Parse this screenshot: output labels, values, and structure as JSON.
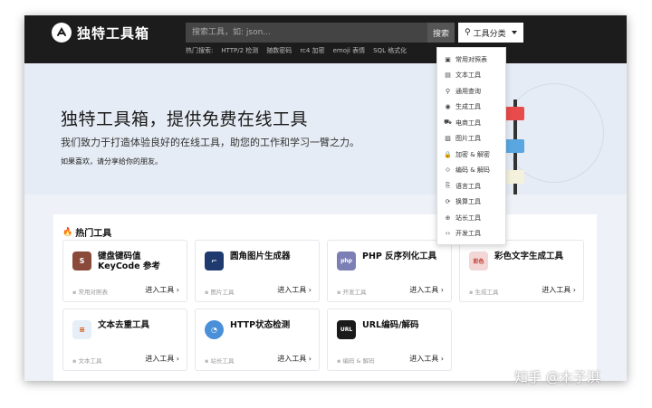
{
  "header": {
    "logo_text": "独特工具箱",
    "search_placeholder": "搜索工具，如: json...",
    "search_button": "搜索",
    "category_button": "工具分类",
    "hot_label": "热门搜索:",
    "hot_items": [
      "HTTP/2 检测",
      "随数密码",
      "rc4 加密",
      "emoji 表情",
      "SQL 格式化"
    ]
  },
  "hero": {
    "title": "独特工具箱，提供免费在线工具",
    "subtitle": "我们致力于打造体验良好的在线工具，助您的工作和学习一臂之力。",
    "share": "如果喜欢，请分享给你的朋友。"
  },
  "hot_tools": {
    "title": "热门工具",
    "go_label": "进入工具",
    "cards": [
      {
        "name": "键盘键码值 KeyCode 参考",
        "category": "常用对照表",
        "icon_bg": "#8a4a3a",
        "icon_text": "S"
      },
      {
        "name": "圆角图片生成器",
        "category": "图片工具",
        "icon_bg": "#1e3a6e",
        "icon_text": "⌐"
      },
      {
        "name": "PHP 反序列化工具",
        "category": "开发工具",
        "icon_bg": "#7b7fb6",
        "icon_text": "php"
      },
      {
        "name": "彩色文字生成工具",
        "category": "生成工具",
        "icon_bg": "#f3d6d6",
        "icon_text": "彩色"
      },
      {
        "name": "文本去重工具",
        "category": "文本工具",
        "icon_bg": "#e6eef8",
        "icon_text": "≡"
      },
      {
        "name": "HTTP状态检测",
        "category": "站长工具",
        "icon_bg": "#4a90d9",
        "icon_text": "◔"
      },
      {
        "name": "URL编码/解码",
        "category": "编码 & 解码",
        "icon_bg": "#1a1a1a",
        "icon_text": "URL"
      }
    ]
  },
  "dropdown": {
    "items": [
      {
        "label": "常用对照表",
        "icon": "▣"
      },
      {
        "label": "文本工具",
        "icon": "▤"
      },
      {
        "label": "通用查询",
        "icon": "⚲"
      },
      {
        "label": "生成工具",
        "icon": "◉"
      },
      {
        "label": "电商工具",
        "icon": "⛟"
      },
      {
        "label": "图片工具",
        "icon": "▨"
      },
      {
        "label": "加密 & 解密",
        "icon": "🔒"
      },
      {
        "label": "编码 & 解码",
        "icon": "⟐"
      },
      {
        "label": "语言工具",
        "icon": "⎘"
      },
      {
        "label": "换算工具",
        "icon": "⟳"
      },
      {
        "label": "站长工具",
        "icon": "⊕"
      },
      {
        "label": "开发工具",
        "icon": "‹›"
      }
    ]
  },
  "watermark": "知乎 @木子淇",
  "colors": {
    "header_bg": "#1c1c1c",
    "hero_bg": "#e6ecf5",
    "flag_red": "#e84b4b",
    "flag_blue": "#5aa6e0",
    "flag_cream": "#f4f1dc"
  }
}
